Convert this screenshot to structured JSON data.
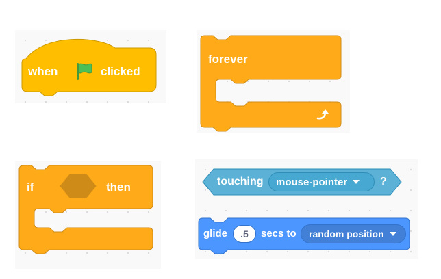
{
  "blocks": {
    "when_flag": {
      "label_when": "when",
      "label_clicked": "clicked",
      "icon": "green-flag-icon",
      "color": "#FFBF00"
    },
    "forever": {
      "label": "forever",
      "icon": "loop-arrow-icon",
      "color": "#FFAB19"
    },
    "if_then": {
      "label_if": "if",
      "label_then": "then",
      "color": "#FFAB19"
    },
    "touching": {
      "label": "touching",
      "menu_value": "mouse-pointer",
      "question": "?",
      "color": "#5CB1D6"
    },
    "glide": {
      "label_glide": "glide",
      "secs_value": ".5",
      "label_secs_to": "secs to",
      "menu_value": "random position",
      "color": "#4C97FF"
    }
  }
}
